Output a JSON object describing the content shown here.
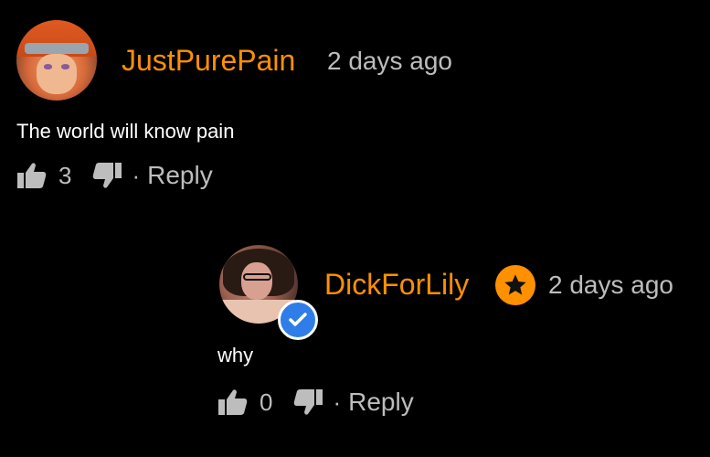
{
  "comments": [
    {
      "username": "JustPurePain",
      "time": "2 days ago",
      "text": "The world will know pain",
      "likes": "3",
      "reply_label": "Reply",
      "separator": "·"
    },
    {
      "username": "DickForLily",
      "time": "2 days ago",
      "text": "why",
      "likes": "0",
      "reply_label": "Reply",
      "separator": "·",
      "verified": true,
      "badge": "star"
    }
  ],
  "colors": {
    "background": "#000000",
    "username": "#ff9000",
    "muted": "#bdbdbd",
    "verified_blue": "#2f7de8"
  },
  "icons": {
    "like": "thumbs-up-icon",
    "dislike": "thumbs-down-icon",
    "verified": "checkmark-icon",
    "badge": "star-icon"
  }
}
